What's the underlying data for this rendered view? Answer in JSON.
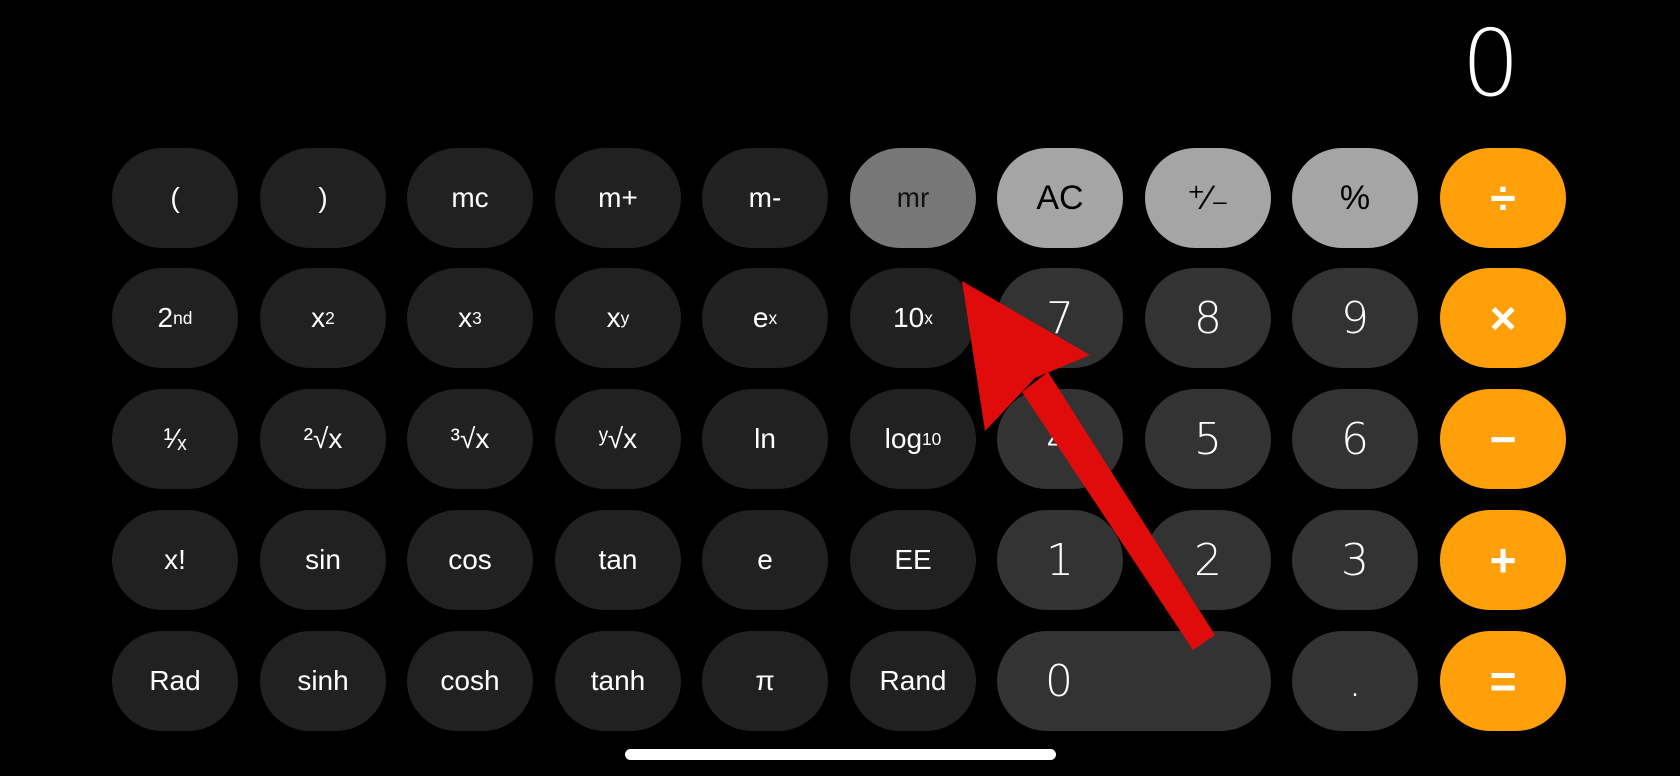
{
  "display": {
    "value": "0"
  },
  "colors": {
    "background": "#000000",
    "scientific_button": "#212121",
    "digit_button": "#333333",
    "function_button": "#a5a5a5",
    "memory_active_button": "#777777",
    "operator_button": "#ff9f0a",
    "annotation_arrow": "#e00b0b"
  },
  "rows": [
    [
      {
        "id": "open-paren",
        "label": "(",
        "kind": "sci"
      },
      {
        "id": "close-paren",
        "label": ")",
        "kind": "sci"
      },
      {
        "id": "mc",
        "label": "mc",
        "kind": "sci"
      },
      {
        "id": "m-plus",
        "label": "m+",
        "kind": "sci"
      },
      {
        "id": "m-minus",
        "label": "m-",
        "kind": "sci"
      },
      {
        "id": "mr",
        "label": "mr",
        "kind": "mem-active"
      },
      {
        "id": "ac",
        "label": "AC",
        "kind": "light"
      },
      {
        "id": "plus-minus",
        "label": "⁺∕₋",
        "kind": "light"
      },
      {
        "id": "percent",
        "label": "%",
        "kind": "light"
      },
      {
        "id": "divide",
        "label": "÷",
        "kind": "op"
      }
    ],
    [
      {
        "id": "second",
        "label": "2",
        "sup": "nd",
        "kind": "sci"
      },
      {
        "id": "x-squared",
        "label": "x",
        "sup": "2",
        "kind": "sci"
      },
      {
        "id": "x-cubed",
        "label": "x",
        "sup": "3",
        "kind": "sci"
      },
      {
        "id": "x-power-y",
        "label": "x",
        "sup": "y",
        "kind": "sci"
      },
      {
        "id": "e-power-x",
        "label": "e",
        "sup": "x",
        "kind": "sci"
      },
      {
        "id": "ten-power-x",
        "label": "10",
        "sup": "x",
        "kind": "sci"
      },
      {
        "id": "digit-7",
        "label": "7",
        "kind": "digit"
      },
      {
        "id": "digit-8",
        "label": "8",
        "kind": "digit"
      },
      {
        "id": "digit-9",
        "label": "9",
        "kind": "digit"
      },
      {
        "id": "multiply",
        "label": "×",
        "kind": "op"
      }
    ],
    [
      {
        "id": "reciprocal",
        "label": "¹∕ₓ",
        "kind": "sci"
      },
      {
        "id": "square-root",
        "label": "²√x",
        "kind": "sci"
      },
      {
        "id": "cube-root",
        "label": "³√x",
        "kind": "sci"
      },
      {
        "id": "y-root",
        "label": "ʸ√x",
        "kind": "sci"
      },
      {
        "id": "ln",
        "label": "ln",
        "kind": "sci"
      },
      {
        "id": "log10",
        "label": "log",
        "sub": "10",
        "kind": "sci"
      },
      {
        "id": "digit-4",
        "label": "4",
        "kind": "digit"
      },
      {
        "id": "digit-5",
        "label": "5",
        "kind": "digit"
      },
      {
        "id": "digit-6",
        "label": "6",
        "kind": "digit"
      },
      {
        "id": "subtract",
        "label": "−",
        "kind": "op"
      }
    ],
    [
      {
        "id": "factorial",
        "label": "x!",
        "kind": "sci"
      },
      {
        "id": "sin",
        "label": "sin",
        "kind": "sci"
      },
      {
        "id": "cos",
        "label": "cos",
        "kind": "sci"
      },
      {
        "id": "tan",
        "label": "tan",
        "kind": "sci"
      },
      {
        "id": "e",
        "label": "e",
        "kind": "sci"
      },
      {
        "id": "ee",
        "label": "EE",
        "kind": "sci"
      },
      {
        "id": "digit-1",
        "label": "1",
        "kind": "digit"
      },
      {
        "id": "digit-2",
        "label": "2",
        "kind": "digit"
      },
      {
        "id": "digit-3",
        "label": "3",
        "kind": "digit"
      },
      {
        "id": "add",
        "label": "+",
        "kind": "op"
      }
    ],
    [
      {
        "id": "rad",
        "label": "Rad",
        "kind": "sci"
      },
      {
        "id": "sinh",
        "label": "sinh",
        "kind": "sci"
      },
      {
        "id": "cosh",
        "label": "cosh",
        "kind": "sci"
      },
      {
        "id": "tanh",
        "label": "tanh",
        "kind": "sci"
      },
      {
        "id": "pi",
        "label": "π",
        "kind": "sci"
      },
      {
        "id": "rand",
        "label": "Rand",
        "kind": "sci"
      },
      {
        "id": "digit-0",
        "label": "0",
        "kind": "digit",
        "wide": true
      },
      {
        "id": "decimal",
        "label": ".",
        "kind": "digit"
      },
      {
        "id": "equals",
        "label": "=",
        "kind": "op"
      }
    ]
  ]
}
